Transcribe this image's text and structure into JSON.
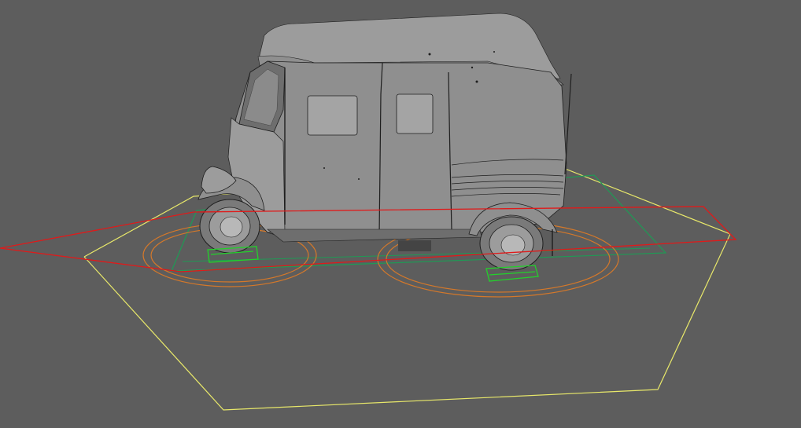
{
  "viewport": {
    "background": "#5d5d5d",
    "model": "auto-rickshaw",
    "colors": {
      "body": "#8f8f8f",
      "body_light": "#9c9c9c",
      "body_dark": "#6e6e6e",
      "window": "#a4a4a4",
      "tire": "#7a7a7a",
      "outline": "#1e1e1e",
      "control_red": "#e01a1a",
      "control_yellow": "#e8e86a",
      "control_green": "#1f9a55",
      "wheel_box_green": "#22d22a",
      "wheel_ring_orange": "#d4782a"
    }
  }
}
